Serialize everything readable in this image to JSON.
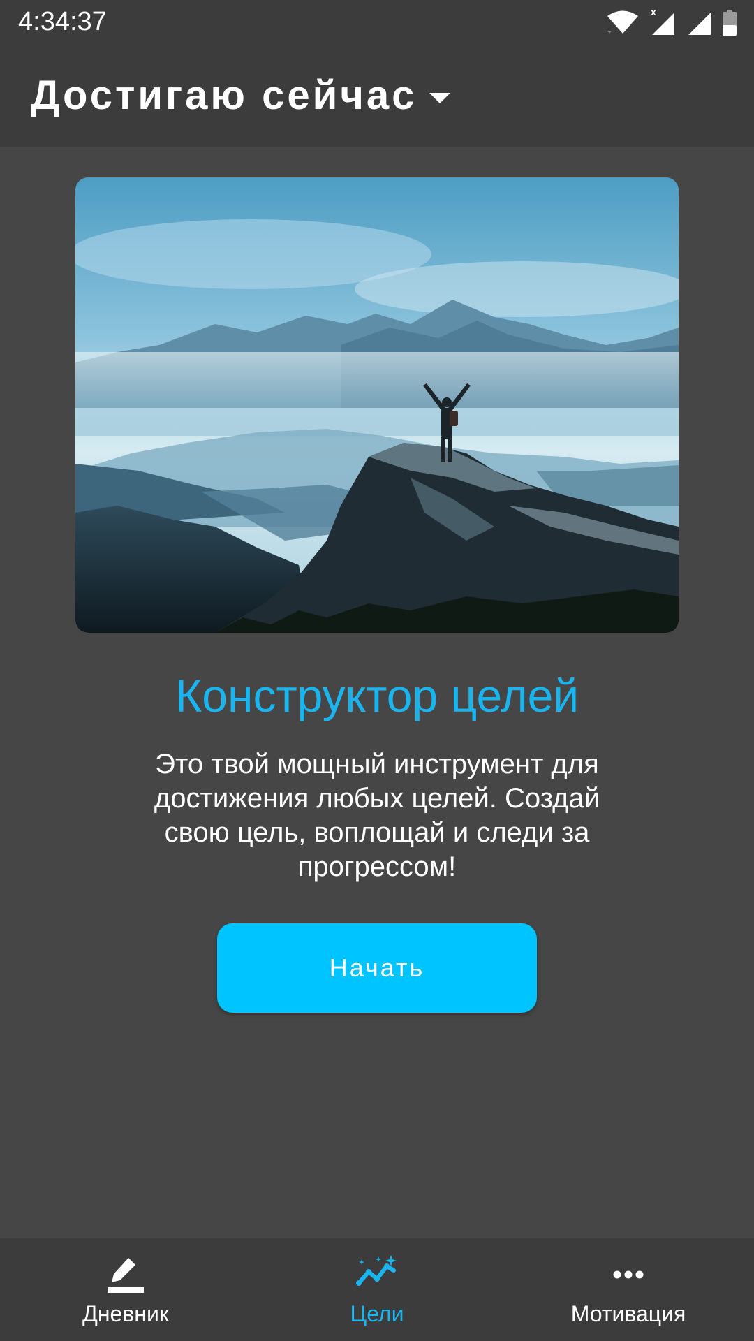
{
  "status_bar": {
    "time": "4:34:37",
    "icons": [
      "wifi-icon",
      "cell-signal-icon",
      "cell-signal-icon",
      "battery-icon"
    ],
    "roaming_mark": "x"
  },
  "app_bar": {
    "title": "Достигаю сейчас",
    "caret_icon": "caret-down-icon"
  },
  "hero": {
    "image": "mountain-summit-hiker-image"
  },
  "main": {
    "headline": "Конструктор целей",
    "description": "Это твой мощный инструмент для достижения любых целей. Создай свою цель, воплощай и следи за прогрессом!",
    "start_button_label": "Начать"
  },
  "bottom_nav": {
    "items": [
      {
        "label": "Дневник",
        "icon": "pencil-icon",
        "active": false
      },
      {
        "label": "Цели",
        "icon": "goals-chart-icon",
        "active": true
      },
      {
        "label": "Мотивация",
        "icon": "more-dots-icon",
        "active": false
      }
    ]
  },
  "colors": {
    "accent": "#1ab4ef",
    "button": "#00c4ff",
    "background": "#464646",
    "bars": "#3c3c3c"
  }
}
